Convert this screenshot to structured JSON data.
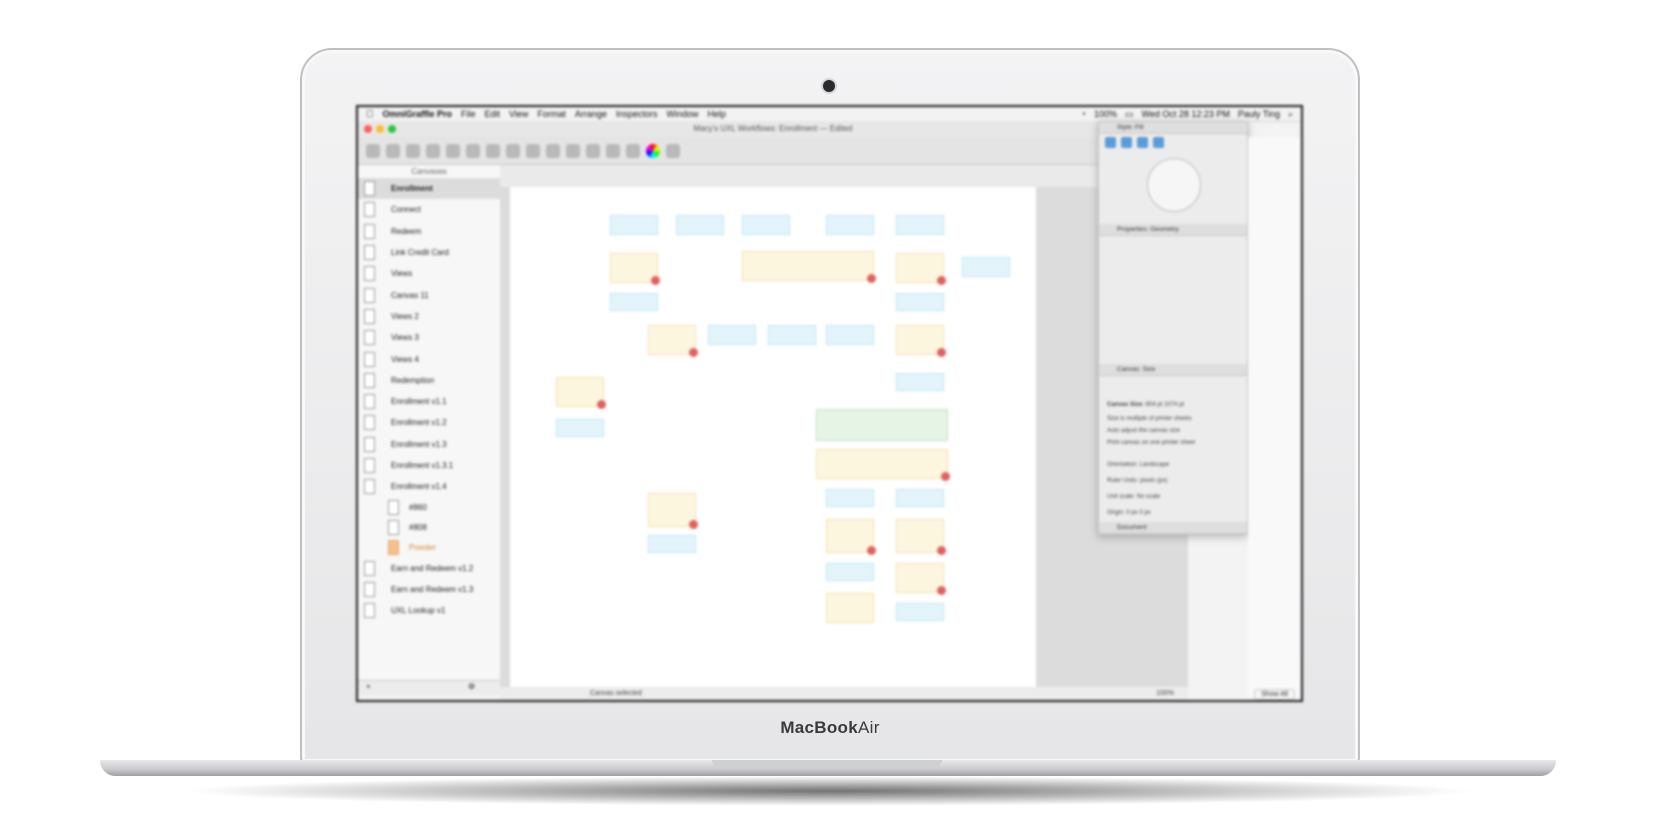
{
  "device": {
    "brand_prefix": "MacBook",
    "brand_model": "Air"
  },
  "menubar": {
    "app_name": "OmniGraffle Pro",
    "menus": [
      "File",
      "Edit",
      "View",
      "Format",
      "Arrange",
      "Inspectors",
      "Window",
      "Help"
    ],
    "battery": "100%",
    "datetime": "Wed Oct 28 12:23 PM",
    "user": "Pauly Ting"
  },
  "window": {
    "title": "Macy's UXL Workflows: Enrollment — Edited"
  },
  "sidebar": {
    "header": "Canvases",
    "items": [
      {
        "label": "Enrollment",
        "selected": true
      },
      {
        "label": "Connect"
      },
      {
        "label": "Redeem"
      },
      {
        "label": "Link Credit Card"
      },
      {
        "label": "Views"
      },
      {
        "label": "Canvas 11"
      },
      {
        "label": "Views 2"
      },
      {
        "label": "Views 3"
      },
      {
        "label": "Views 4"
      },
      {
        "label": "Redemption"
      },
      {
        "label": "Enrollment v1.1"
      },
      {
        "label": "Enrollment v1.2"
      },
      {
        "label": "Enrollment v1.3"
      },
      {
        "label": "Enrollment v1.3.1"
      },
      {
        "label": "Enrollment v1.4"
      }
    ],
    "sub_items": [
      {
        "label": "#860"
      },
      {
        "label": "#808"
      },
      {
        "label": "Powder",
        "accent": "#d5883b"
      }
    ],
    "items_after": [
      {
        "label": "Earn and Redeem v1.2"
      },
      {
        "label": "Earn and Redeem v1.3"
      },
      {
        "label": "UXL Lookup v1"
      }
    ]
  },
  "status": {
    "message": "Canvas selected",
    "zoom": "100%",
    "show_all": "Show All"
  },
  "inspector": {
    "style_header": "Style: Fill",
    "props_header": "Properties: Geometry",
    "canvas_header": "Canvas: Size",
    "canvas_size_label": "Canvas Size:",
    "width": "804 pt",
    "height": "1074 pt",
    "options": [
      "Size is multiple of printer sheets",
      "Auto adjust the canvas size",
      "Print canvas on one printer sheet"
    ],
    "orientation_label": "Orientation:",
    "orientation_value": "Landscape",
    "ruler_units_label": "Ruler Units:",
    "ruler_units_value": "pixels (px)",
    "unit_scale_label": "Unit scale:",
    "unit_scale_value": "No scale",
    "origin_label": "Origin:",
    "origin_x": "0 px",
    "origin_y": "0 px",
    "document_header": "Document"
  },
  "colors": {
    "cyan_fill": "#e3f5fb",
    "yellow_fill": "#fdf6df",
    "green_fill": "#e6f4e6",
    "badge": "#e06060",
    "traffic_red": "#ff5f57",
    "traffic_yellow": "#febc2e",
    "traffic_green": "#28c840"
  },
  "icons": [
    "apple-icon",
    "wifi-icon",
    "battery-icon",
    "search-icon",
    "color-wheel-icon",
    "gear-icon"
  ]
}
